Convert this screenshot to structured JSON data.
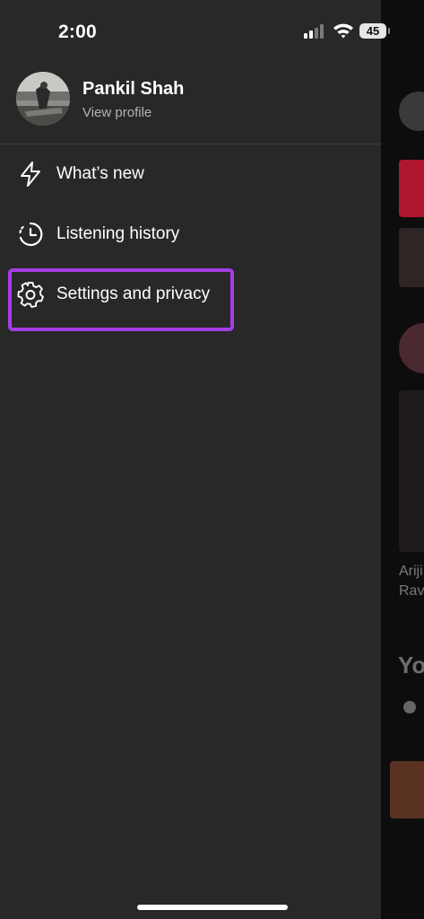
{
  "status_bar": {
    "time": "2:00",
    "battery": "45"
  },
  "profile": {
    "name": "Pankil Shah",
    "link": "View profile"
  },
  "menu": [
    {
      "label": "What’s new",
      "icon": "lightning-icon"
    },
    {
      "label": "Listening history",
      "icon": "history-clock-icon"
    },
    {
      "label": "Settings and privacy",
      "icon": "gear-icon"
    }
  ],
  "background": {
    "text1": "Ariji",
    "text2": "Ravi",
    "heading": "Yo"
  },
  "colors": {
    "drawer": "#282828",
    "highlight": "#a53ee6",
    "accent_red": "#b0162d"
  }
}
